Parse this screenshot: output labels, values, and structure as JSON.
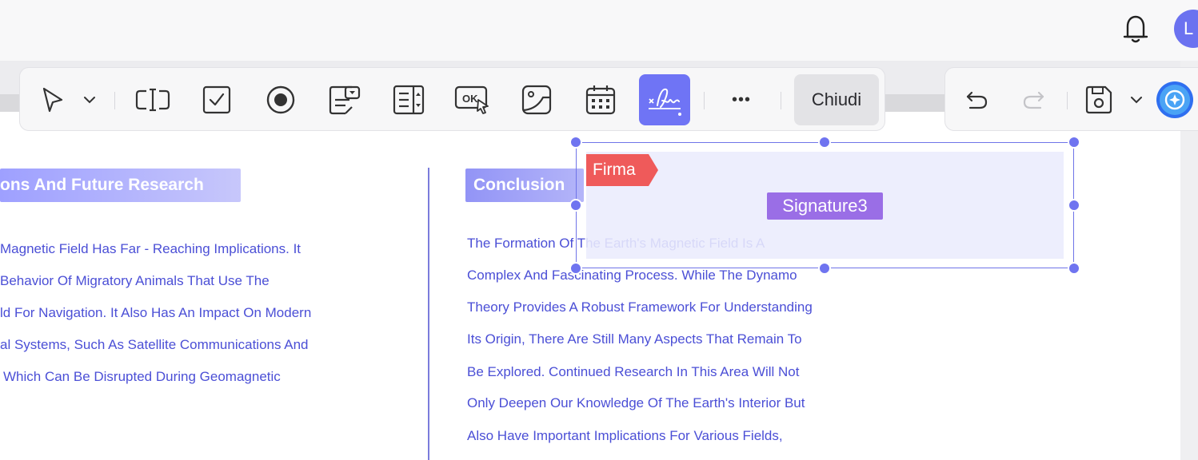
{
  "header": {
    "notification_icon": "bell-icon",
    "avatar_initial": "L"
  },
  "toolbar": {
    "tools": [
      {
        "name": "select-tool",
        "icon": "pointer-arrow-icon"
      },
      {
        "name": "text-field-tool",
        "icon": "text-field-icon"
      },
      {
        "name": "checkbox-tool",
        "icon": "checkbox-icon"
      },
      {
        "name": "radio-button-tool",
        "icon": "radio-button-icon"
      },
      {
        "name": "combo-box-tool",
        "icon": "combo-box-icon"
      },
      {
        "name": "list-box-tool",
        "icon": "list-box-icon"
      },
      {
        "name": "button-tool",
        "icon": "ok-button-icon"
      },
      {
        "name": "image-tool",
        "icon": "image-icon"
      },
      {
        "name": "date-tool",
        "icon": "calendar-icon"
      },
      {
        "name": "signature-tool",
        "icon": "signature-icon",
        "active": true
      }
    ],
    "ok_glyph": "OK",
    "more_glyph": "•••",
    "close_label": "Chiudi",
    "accent_color": "#6f74f5"
  },
  "document": {
    "left_heading": "ons And Future Research",
    "right_heading": "Conclusion",
    "left_lines": [
      "Magnetic Field Has Far - Reaching Implications. It",
      "Behavior Of Migratory Animals That Use The",
      "ld For Navigation. It Also Has An Impact On Modern",
      "al Systems, Such As Satellite Communications And",
      "Which Can Be Disrupted During Geomagnetic"
    ],
    "right_lines": [
      "The Formation Of The Earth's Magnetic Field Is A",
      "Complex And Fascinating Process. While The Dynamo",
      "Theory Provides A Robust Framework For Understanding",
      "Its Origin, There Are Still Many Aspects That Remain To",
      "Be Explored. Continued Research In This Area Will Not",
      "Only Deepen Our Knowledge Of The Earth's Interior But",
      "Also Have Important Implications For Various Fields,"
    ],
    "text_color": "#4b4fd6"
  },
  "signature_field": {
    "tag": "Firma",
    "name": "Signature3",
    "tag_color": "#ef5a5a",
    "name_color": "#9a6ee6"
  }
}
